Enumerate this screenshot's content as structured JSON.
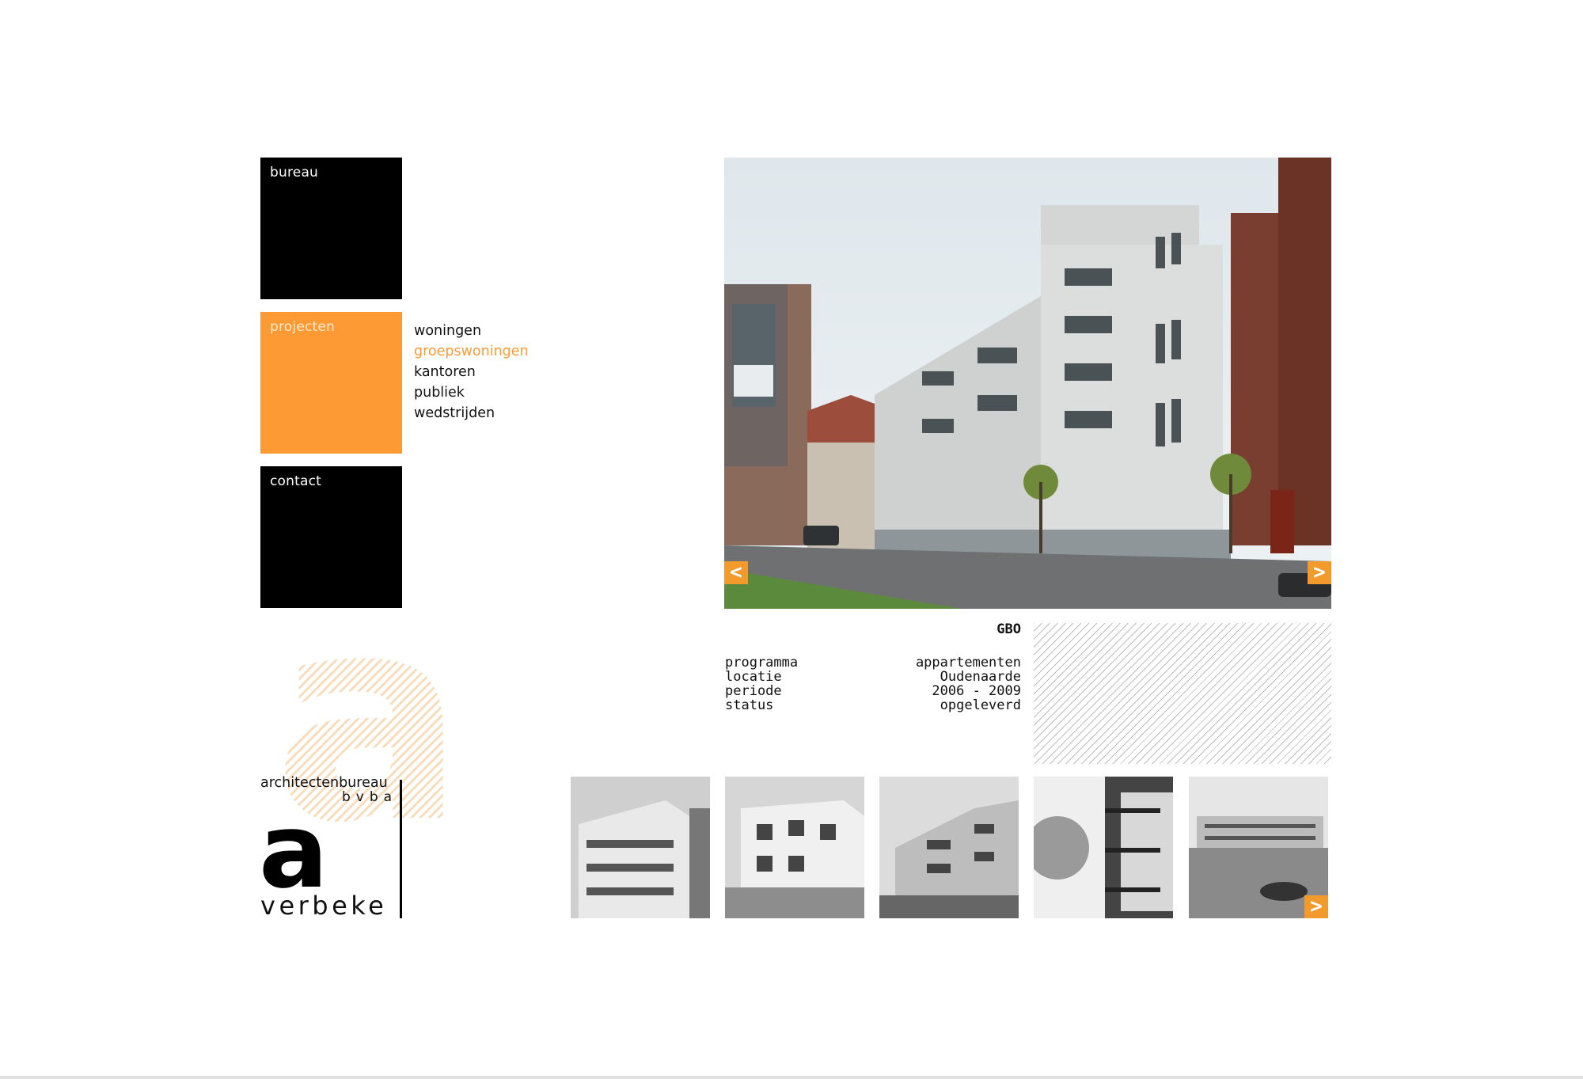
{
  "nav": {
    "bureau": "bureau",
    "projecten": "projecten",
    "contact": "contact"
  },
  "submenu": [
    "woningen",
    "groepswoningen",
    "kantoren",
    "publiek",
    "wedstrijden"
  ],
  "project": {
    "title": "GBO",
    "labels": [
      "programma",
      "locatie",
      "periode",
      "status"
    ],
    "values": [
      "appartementen",
      "Oudenaarde",
      "2006 - 2009",
      "opgeleverd"
    ]
  },
  "arrows": {
    "prev": "<",
    "next": ">"
  },
  "logo": {
    "line1": "architectenbureau",
    "line2": "bvba",
    "letter": "a",
    "line3": "verbeke"
  },
  "colors": {
    "accent": "#fd9a33",
    "nav_block": "#000000"
  }
}
